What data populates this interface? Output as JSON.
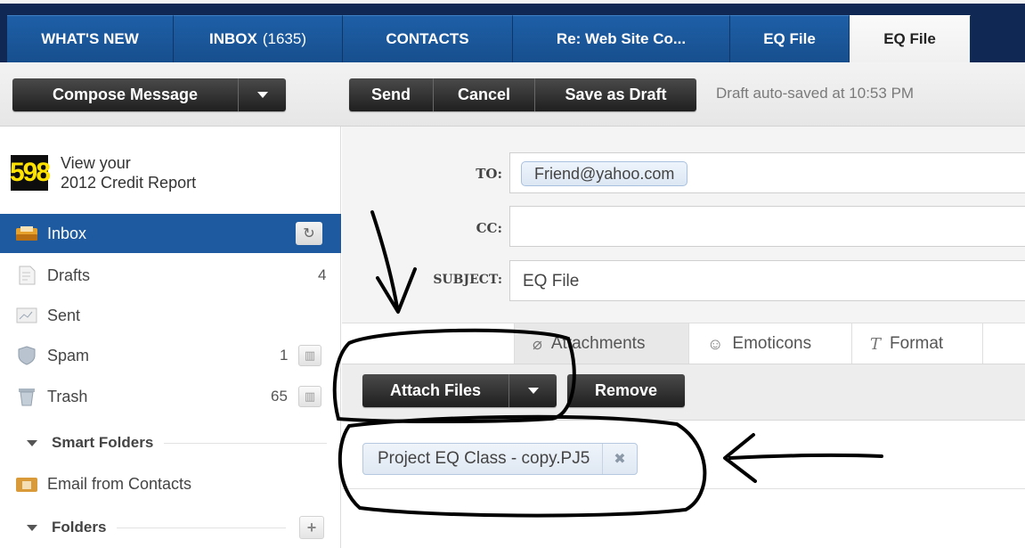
{
  "tabs": [
    {
      "label": "WHAT'S NEW",
      "count": ""
    },
    {
      "label": "INBOX",
      "count": "(1635)"
    },
    {
      "label": "CONTACTS",
      "count": ""
    },
    {
      "label": "Re: Web Site Co...",
      "count": ""
    },
    {
      "label": "EQ File",
      "count": ""
    },
    {
      "label": "EQ File",
      "count": ""
    }
  ],
  "toolbar": {
    "compose_label": "Compose Message",
    "send_label": "Send",
    "cancel_label": "Cancel",
    "save_draft_label": "Save as Draft",
    "autosave_text": "Draft auto-saved at 10:53 PM"
  },
  "ad": {
    "badge": "598",
    "line1": "View your",
    "line2": "2012 Credit Report"
  },
  "sidebar": {
    "items": [
      {
        "label": "Inbox",
        "count": "",
        "icon": "inbox-icon"
      },
      {
        "label": "Drafts",
        "count": "4",
        "icon": "drafts-icon"
      },
      {
        "label": "Sent",
        "count": "",
        "icon": "sent-icon"
      },
      {
        "label": "Spam",
        "count": "1",
        "icon": "spam-shield-icon"
      },
      {
        "label": "Trash",
        "count": "65",
        "icon": "trash-icon"
      }
    ],
    "smart_folders_label": "Smart Folders",
    "email_from_contacts_label": "Email from Contacts",
    "folders_label": "Folders"
  },
  "compose": {
    "to_label": "TO:",
    "to_recipient": "Friend@yahoo.com",
    "cc_label": "CC:",
    "subject_label": "SUBJECT:",
    "subject_value": "EQ File"
  },
  "subtabs": {
    "attachments_label": "Attachments",
    "emoticons_label": "Emoticons",
    "format_label": "Format"
  },
  "attach": {
    "attach_files_label": "Attach Files",
    "remove_label": "Remove",
    "file_name": "Project EQ Class - copy.PJ5"
  },
  "colors": {
    "tab_blue": "#1e5fa7",
    "navy": "#0f2954",
    "selected_blue": "#1e5aa0",
    "button_dark": "#2b2b2b"
  }
}
